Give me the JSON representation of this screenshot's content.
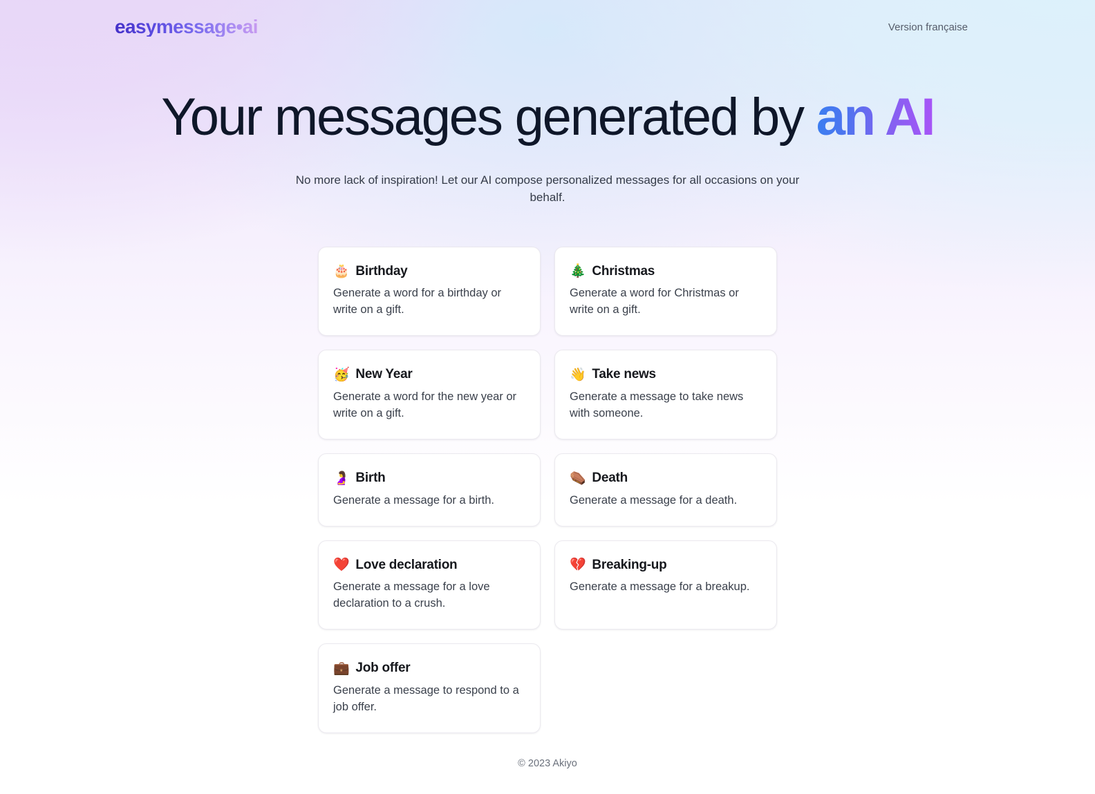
{
  "header": {
    "brand": "easymessage•ai",
    "lang_link": "Version française"
  },
  "hero": {
    "title_main": "Your messages generated by ",
    "title_accent": "an AI",
    "subtitle": "No more lack of inspiration! Let our AI compose personalized messages for all occasions on your behalf."
  },
  "colors": {
    "brand_gradient_start": "#4430c8",
    "brand_gradient_end": "#c79bf0",
    "accent_gradient_start": "#3b7ef0",
    "accent_gradient_end": "#a855f7",
    "heading": "#0f1729",
    "body_text": "#343b48",
    "card_bg": "#ffffff",
    "card_border": "#ebe9ef",
    "bg_top_left": "#e8d7f8",
    "bg_top_right": "#dcf2fb",
    "bg_bottom": "#ffffff"
  },
  "cards": [
    {
      "id": "birthday",
      "emoji": "🎂",
      "emoji_name": "birthday-cake-icon",
      "title": "Birthday",
      "desc": "Generate a word for a birthday or write on a gift."
    },
    {
      "id": "christmas",
      "emoji": "🎄",
      "emoji_name": "christmas-tree-icon",
      "title": "Christmas",
      "desc": "Generate a word for Christmas or write on a gift."
    },
    {
      "id": "new-year",
      "emoji": "🥳",
      "emoji_name": "partying-face-icon",
      "title": "New Year",
      "desc": "Generate a word for the new year or write on a gift."
    },
    {
      "id": "take-news",
      "emoji": "👋",
      "emoji_name": "waving-hand-icon",
      "title": "Take news",
      "desc": "Generate a message to take news with someone."
    },
    {
      "id": "birth",
      "emoji": "🤰",
      "emoji_name": "pregnant-woman-icon",
      "title": "Birth",
      "desc": "Generate a message for a birth."
    },
    {
      "id": "death",
      "emoji": "⚰️",
      "emoji_name": "coffin-icon",
      "title": "Death",
      "desc": "Generate a message for a death."
    },
    {
      "id": "love-declaration",
      "emoji": "❤️",
      "emoji_name": "red-heart-icon",
      "title": "Love declaration",
      "desc": "Generate a message for a love declaration to a crush."
    },
    {
      "id": "breaking-up",
      "emoji": "💔",
      "emoji_name": "broken-heart-icon",
      "title": "Breaking-up",
      "desc": "Generate a message for a breakup."
    },
    {
      "id": "job-offer",
      "emoji": "💼",
      "emoji_name": "briefcase-icon",
      "title": "Job offer",
      "desc": "Generate a message to respond to a job offer."
    }
  ],
  "footer": {
    "copyright": "© 2023 Akiyo"
  }
}
